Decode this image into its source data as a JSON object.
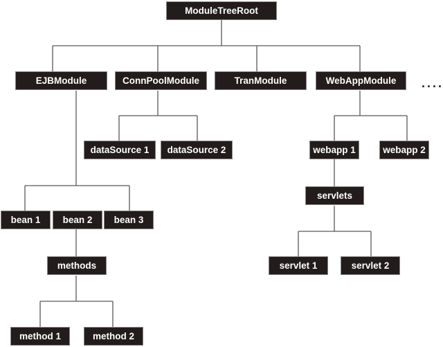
{
  "diagram": {
    "type": "tree",
    "root": {
      "id": "root",
      "label": "ModuleTreeRoot",
      "children": [
        {
          "id": "ejb",
          "label": "EJBModule",
          "children": [
            {
              "id": "bean1",
              "label": "bean 1"
            },
            {
              "id": "bean2",
              "label": "bean 2",
              "children": [
                {
                  "id": "methods",
                  "label": "methods",
                  "children": [
                    {
                      "id": "method1",
                      "label": "method 1"
                    },
                    {
                      "id": "method2",
                      "label": "method 2"
                    }
                  ]
                }
              ]
            },
            {
              "id": "bean3",
              "label": "bean 3"
            }
          ]
        },
        {
          "id": "connpool",
          "label": "ConnPoolModule",
          "children": [
            {
              "id": "ds1",
              "label": "dataSource 1"
            },
            {
              "id": "ds2",
              "label": "dataSource 2"
            }
          ]
        },
        {
          "id": "tran",
          "label": "TranModule"
        },
        {
          "id": "webapp",
          "label": "WebAppModule",
          "children": [
            {
              "id": "webapp1",
              "label": "webapp 1",
              "children": [
                {
                  "id": "servlets",
                  "label": "servlets",
                  "children": [
                    {
                      "id": "servlet1",
                      "label": "servlet 1"
                    },
                    {
                      "id": "servlet2",
                      "label": "servlet 2"
                    }
                  ]
                }
              ]
            },
            {
              "id": "webapp2",
              "label": "webapp 2"
            }
          ]
        }
      ]
    },
    "continuation_marker": "...."
  },
  "labels": {
    "root": "ModuleTreeRoot",
    "ejb": "EJBModule",
    "connpool": "ConnPoolModule",
    "tran": "TranModule",
    "webapp": "WebAppModule",
    "ds1": "dataSource 1",
    "ds2": "dataSource 2",
    "webapp1": "webapp 1",
    "webapp2": "webapp 2",
    "servlets": "servlets",
    "bean1": "bean 1",
    "bean2": "bean 2",
    "bean3": "bean 3",
    "methods": "methods",
    "method1": "method 1",
    "method2": "method 2",
    "servlet1": "servlet 1",
    "servlet2": "servlet 2",
    "more": "...."
  }
}
